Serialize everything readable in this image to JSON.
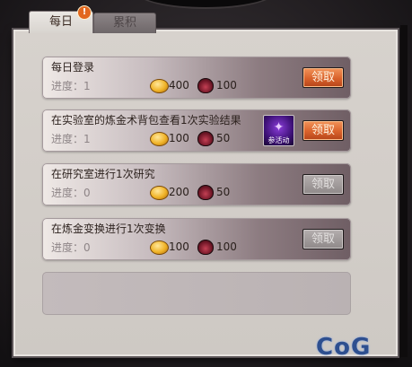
{
  "tabs": [
    {
      "label": "每日",
      "active": true
    },
    {
      "label": "累积",
      "active": false
    }
  ],
  "alert_badge": "!",
  "tasks": [
    {
      "title": "每日登录",
      "progress": "进度：1",
      "coins": "400",
      "potions": "100",
      "button": "领取",
      "claimable": true,
      "event": ""
    },
    {
      "title": "在实验室的炼金术背包查看1次实验结果",
      "progress": "进度：1",
      "coins": "100",
      "potions": "50",
      "button": "领取",
      "claimable": true,
      "event": "参活动"
    },
    {
      "title": "在研究室进行1次研究",
      "progress": "进度：0",
      "coins": "200",
      "potions": "50",
      "button": "领取",
      "claimable": false,
      "event": ""
    },
    {
      "title": "在炼金变换进行1次变换",
      "progress": "进度：0",
      "coins": "100",
      "potions": "100",
      "button": "领取",
      "claimable": false,
      "event": ""
    }
  ],
  "watermark": "CoG",
  "colors": {
    "claim_active": "#d9622b",
    "claim_disabled": "#8f8989",
    "coin": "#f0b327",
    "potion": "#6e1626"
  }
}
